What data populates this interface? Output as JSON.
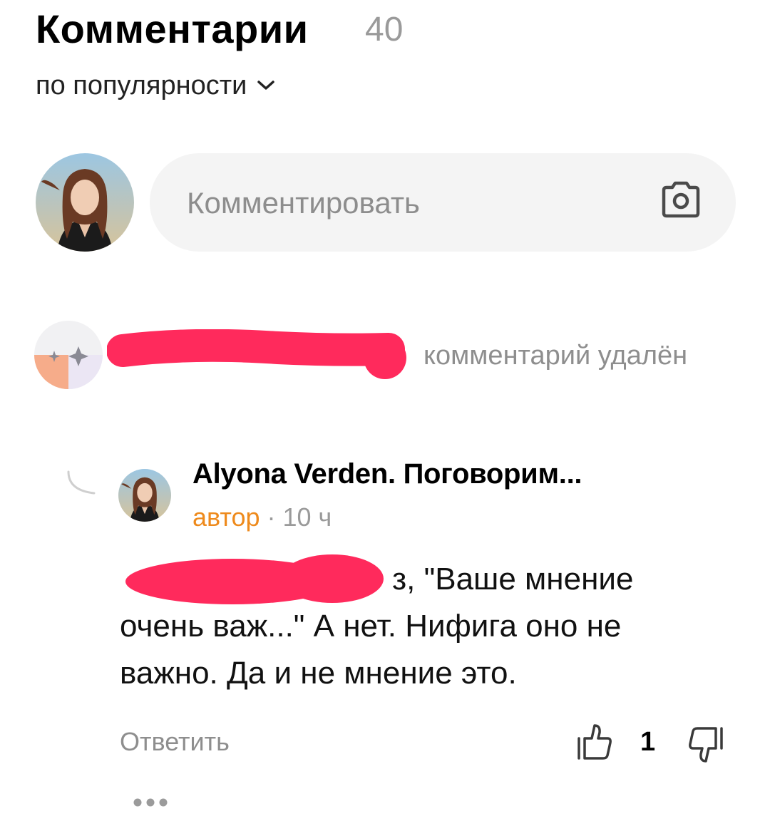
{
  "header": {
    "title": "Комментарии",
    "count": "40",
    "sort_label": "по популярности"
  },
  "composer": {
    "placeholder": "Комментировать"
  },
  "deleted_comment": {
    "status_text": "комментарий удалён"
  },
  "reply": {
    "author_name": "Alyona Verden. Поговорим...",
    "role": "автор",
    "separator": " · ",
    "time": "10 ч",
    "text": "з, \"Ваше мнение очень важ...\" А нет. Нифига оно не важно. Да и не мнение это.",
    "reply_label": "Ответить",
    "likes": "1"
  },
  "colors": {
    "accent_orange": "#ee8a1c",
    "redaction": "#ff2a5c",
    "muted_text": "#8e8e8e"
  },
  "icons": {
    "sort": "chevron-down-icon",
    "composer": "camera-icon",
    "like": "thumbs-up-icon",
    "dislike": "thumbs-down-icon",
    "more": "more-dots-icon",
    "thread": "reply-thread-icon"
  }
}
